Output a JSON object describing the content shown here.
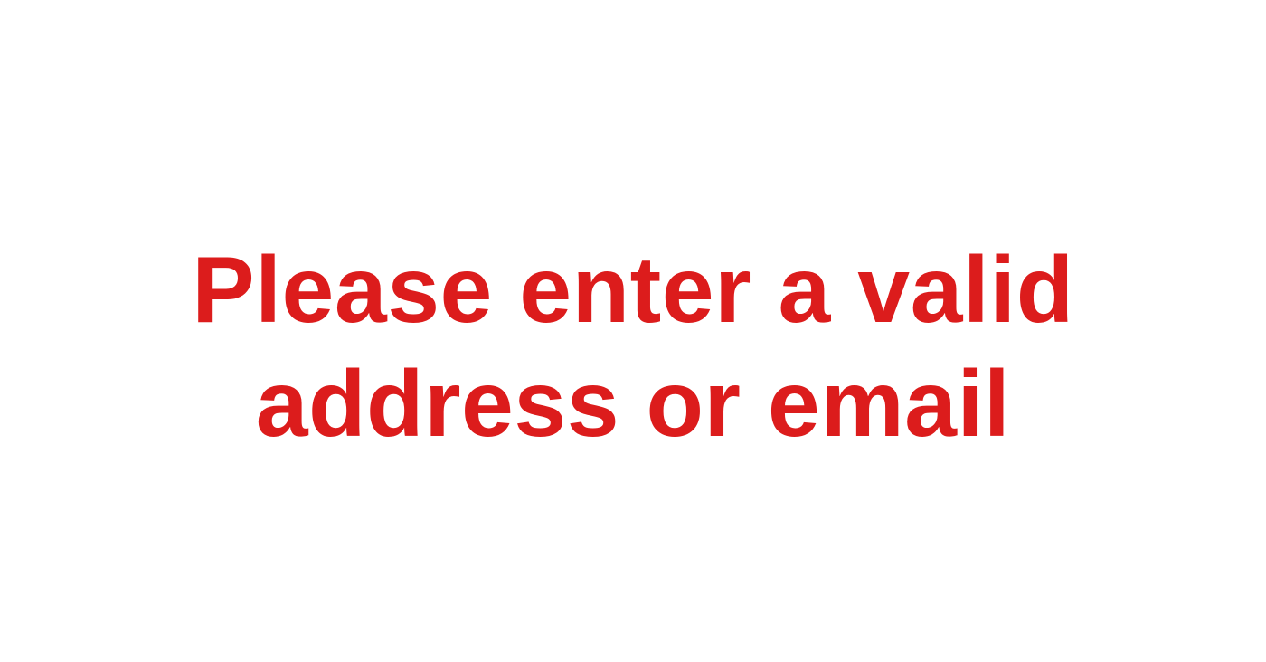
{
  "error_message": {
    "line_1": "Please enter a valid",
    "line_2": "address or email",
    "color": "#dc1c1c"
  },
  "background_color": "#ffffff"
}
